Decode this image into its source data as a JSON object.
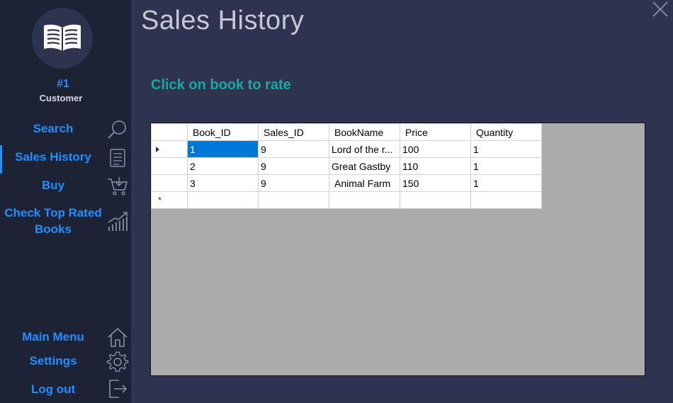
{
  "header": {
    "title": "Sales History",
    "subtitle": "Click on book to rate"
  },
  "user": {
    "rank": "#1",
    "role": "Customer"
  },
  "nav": {
    "search": "Search",
    "sales_history": "Sales History",
    "buy": "Buy",
    "top_rated_line1": "Check Top Rated",
    "top_rated_line2": "Books",
    "main_menu": "Main Menu",
    "settings": "Settings",
    "logout": "Log out"
  },
  "table": {
    "columns": [
      "Book_ID",
      "Sales_ID",
      "BookName",
      "Price",
      "Quantity"
    ],
    "rows": [
      [
        "1",
        "9",
        "Lord of the r...",
        "100",
        "1"
      ],
      [
        "2",
        "9",
        "Great Gastby",
        "110",
        "1"
      ],
      [
        "3",
        "9",
        "Animal Farm",
        "150",
        "1"
      ]
    ],
    "new_row_marker": "*"
  },
  "colors": {
    "accent": "#1e90ff",
    "sidebar": "#1e2235",
    "background": "#2e3350",
    "subtitle": "#1aa9a0",
    "selection": "#0078d7"
  },
  "icons": {
    "logo": "open-book-icon",
    "search": "search-icon",
    "sales_history": "receipt-icon",
    "buy": "cart-icon",
    "top_rated": "chart-growth-icon",
    "main_menu": "home-icon",
    "settings": "gear-icon",
    "logout": "logout-icon",
    "close": "close-icon"
  }
}
